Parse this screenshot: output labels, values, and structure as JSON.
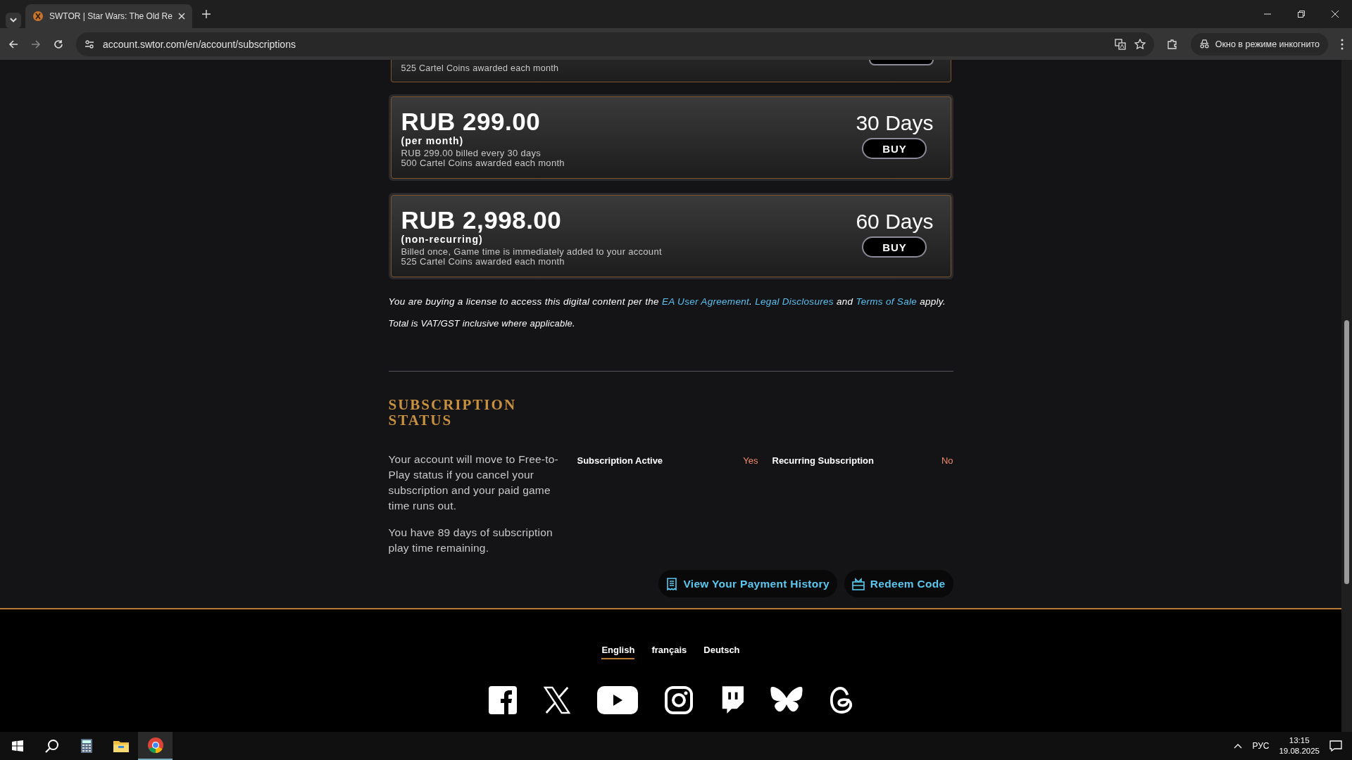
{
  "browser": {
    "tab_title": "SWTOR | Star Wars: The Old Re",
    "url": "account.swtor.com/en/account/subscriptions",
    "incognito_label": "Окно в режиме инкогнито"
  },
  "plans_partial": {
    "lines": [
      "525 Cartel Coins awarded each month"
    ]
  },
  "plans": [
    {
      "price": "RUB 299.00",
      "term": "(per month)",
      "lines": [
        "RUB 299.00 billed every 30 days",
        "500 Cartel Coins awarded each month"
      ],
      "duration": "30 Days",
      "button": "BUY"
    },
    {
      "price": "RUB 2,998.00",
      "term": "(non-recurring)",
      "lines": [
        "Billed once, Game time is immediately added to your account",
        "525 Cartel Coins awarded each month"
      ],
      "duration": "60 Days",
      "button": "BUY"
    }
  ],
  "legal": [
    {
      "kind": "text",
      "text": "You are buying a license to access this digital content per the "
    },
    {
      "kind": "link",
      "text": "EA User Agreement"
    },
    {
      "kind": "text",
      "text": ". "
    },
    {
      "kind": "link",
      "text": "Legal Disclosures"
    },
    {
      "kind": "text",
      "text": " and "
    },
    {
      "kind": "link",
      "text": "Terms of Sale"
    },
    {
      "kind": "text",
      "text": " apply."
    }
  ],
  "vat_note": "Total is VAT/GST inclusive where applicable.",
  "status": {
    "heading": "SUBSCRIPTION STATUS",
    "paragraphs": [
      "Your account will move to Free-to-Play status if you cancel your subscription and your paid game time runs out.",
      "You have 89 days of subscription play time remaining."
    ],
    "fields": [
      {
        "label": "Subscription Active",
        "value": "Yes"
      },
      {
        "label": "Recurring Subscription",
        "value": "No"
      }
    ]
  },
  "actions": [
    {
      "kind": "history",
      "label": "View Your Payment History"
    },
    {
      "kind": "redeem",
      "label": "Redeem Code"
    }
  ],
  "languages": [
    {
      "label": "English",
      "selected": true
    },
    {
      "label": "français",
      "selected": false
    },
    {
      "label": "Deutsch",
      "selected": false
    }
  ],
  "taskbar": {
    "language": "РУС",
    "time": "13:15",
    "date": "19.08.2025"
  }
}
